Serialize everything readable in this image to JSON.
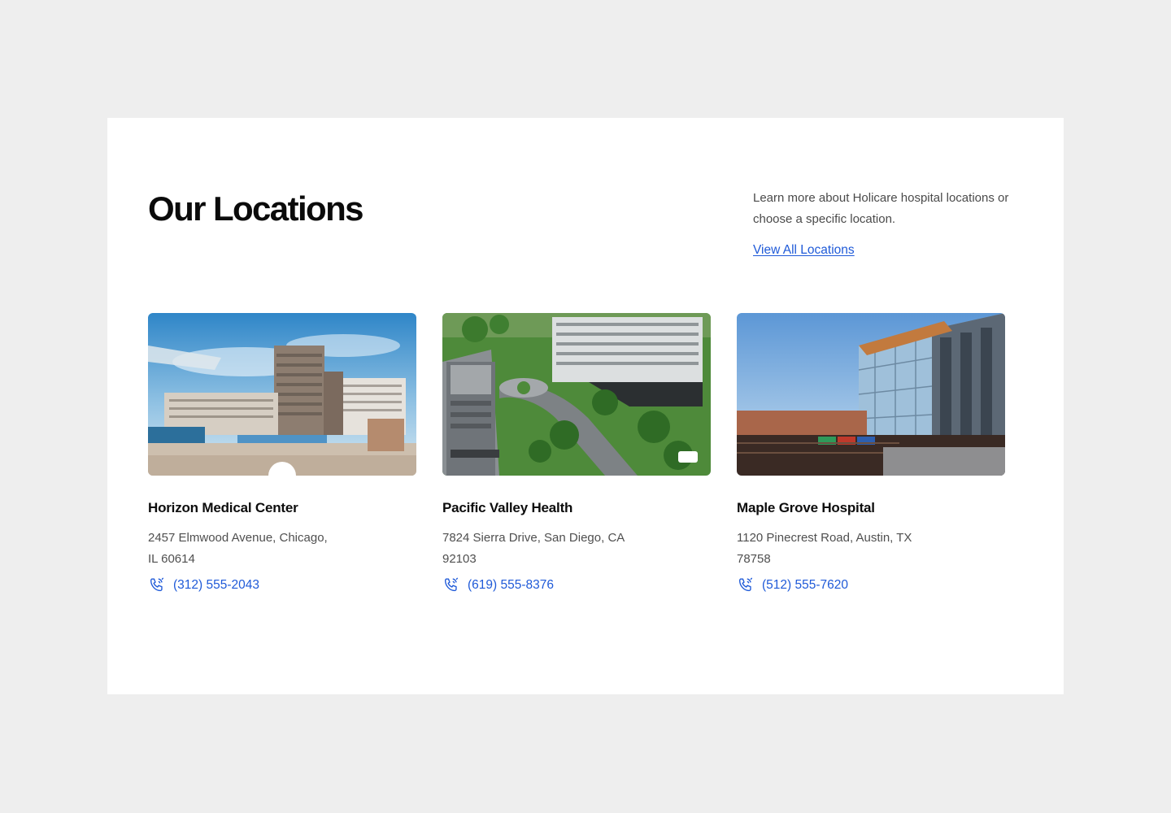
{
  "section": {
    "title": "Our Locations",
    "intro": "Learn more about Holicare hospital locations or choose a specific location.",
    "view_all_label": "View All Locations"
  },
  "locations": [
    {
      "name": "Horizon Medical Center",
      "address": "2457 Elmwood Avenue, Chicago, IL 60614",
      "phone": "(312) 555-2043",
      "phone_icon": "phone-icon"
    },
    {
      "name": "Pacific Valley Health",
      "address": "7824 Sierra Drive, San Diego, CA 92103",
      "phone": "(619) 555-8376",
      "phone_icon": "phone-icon"
    },
    {
      "name": "Maple Grove Hospital",
      "address": "1120 Pinecrest Road, Austin, TX 78758",
      "phone": "(512) 555-7620",
      "phone_icon": "phone-icon"
    }
  ],
  "colors": {
    "page_background": "#eeeeee",
    "panel_background": "#ffffff",
    "link": "#1f5ad8",
    "heading": "#0b0b0b",
    "body_text": "#4f4f4f"
  }
}
